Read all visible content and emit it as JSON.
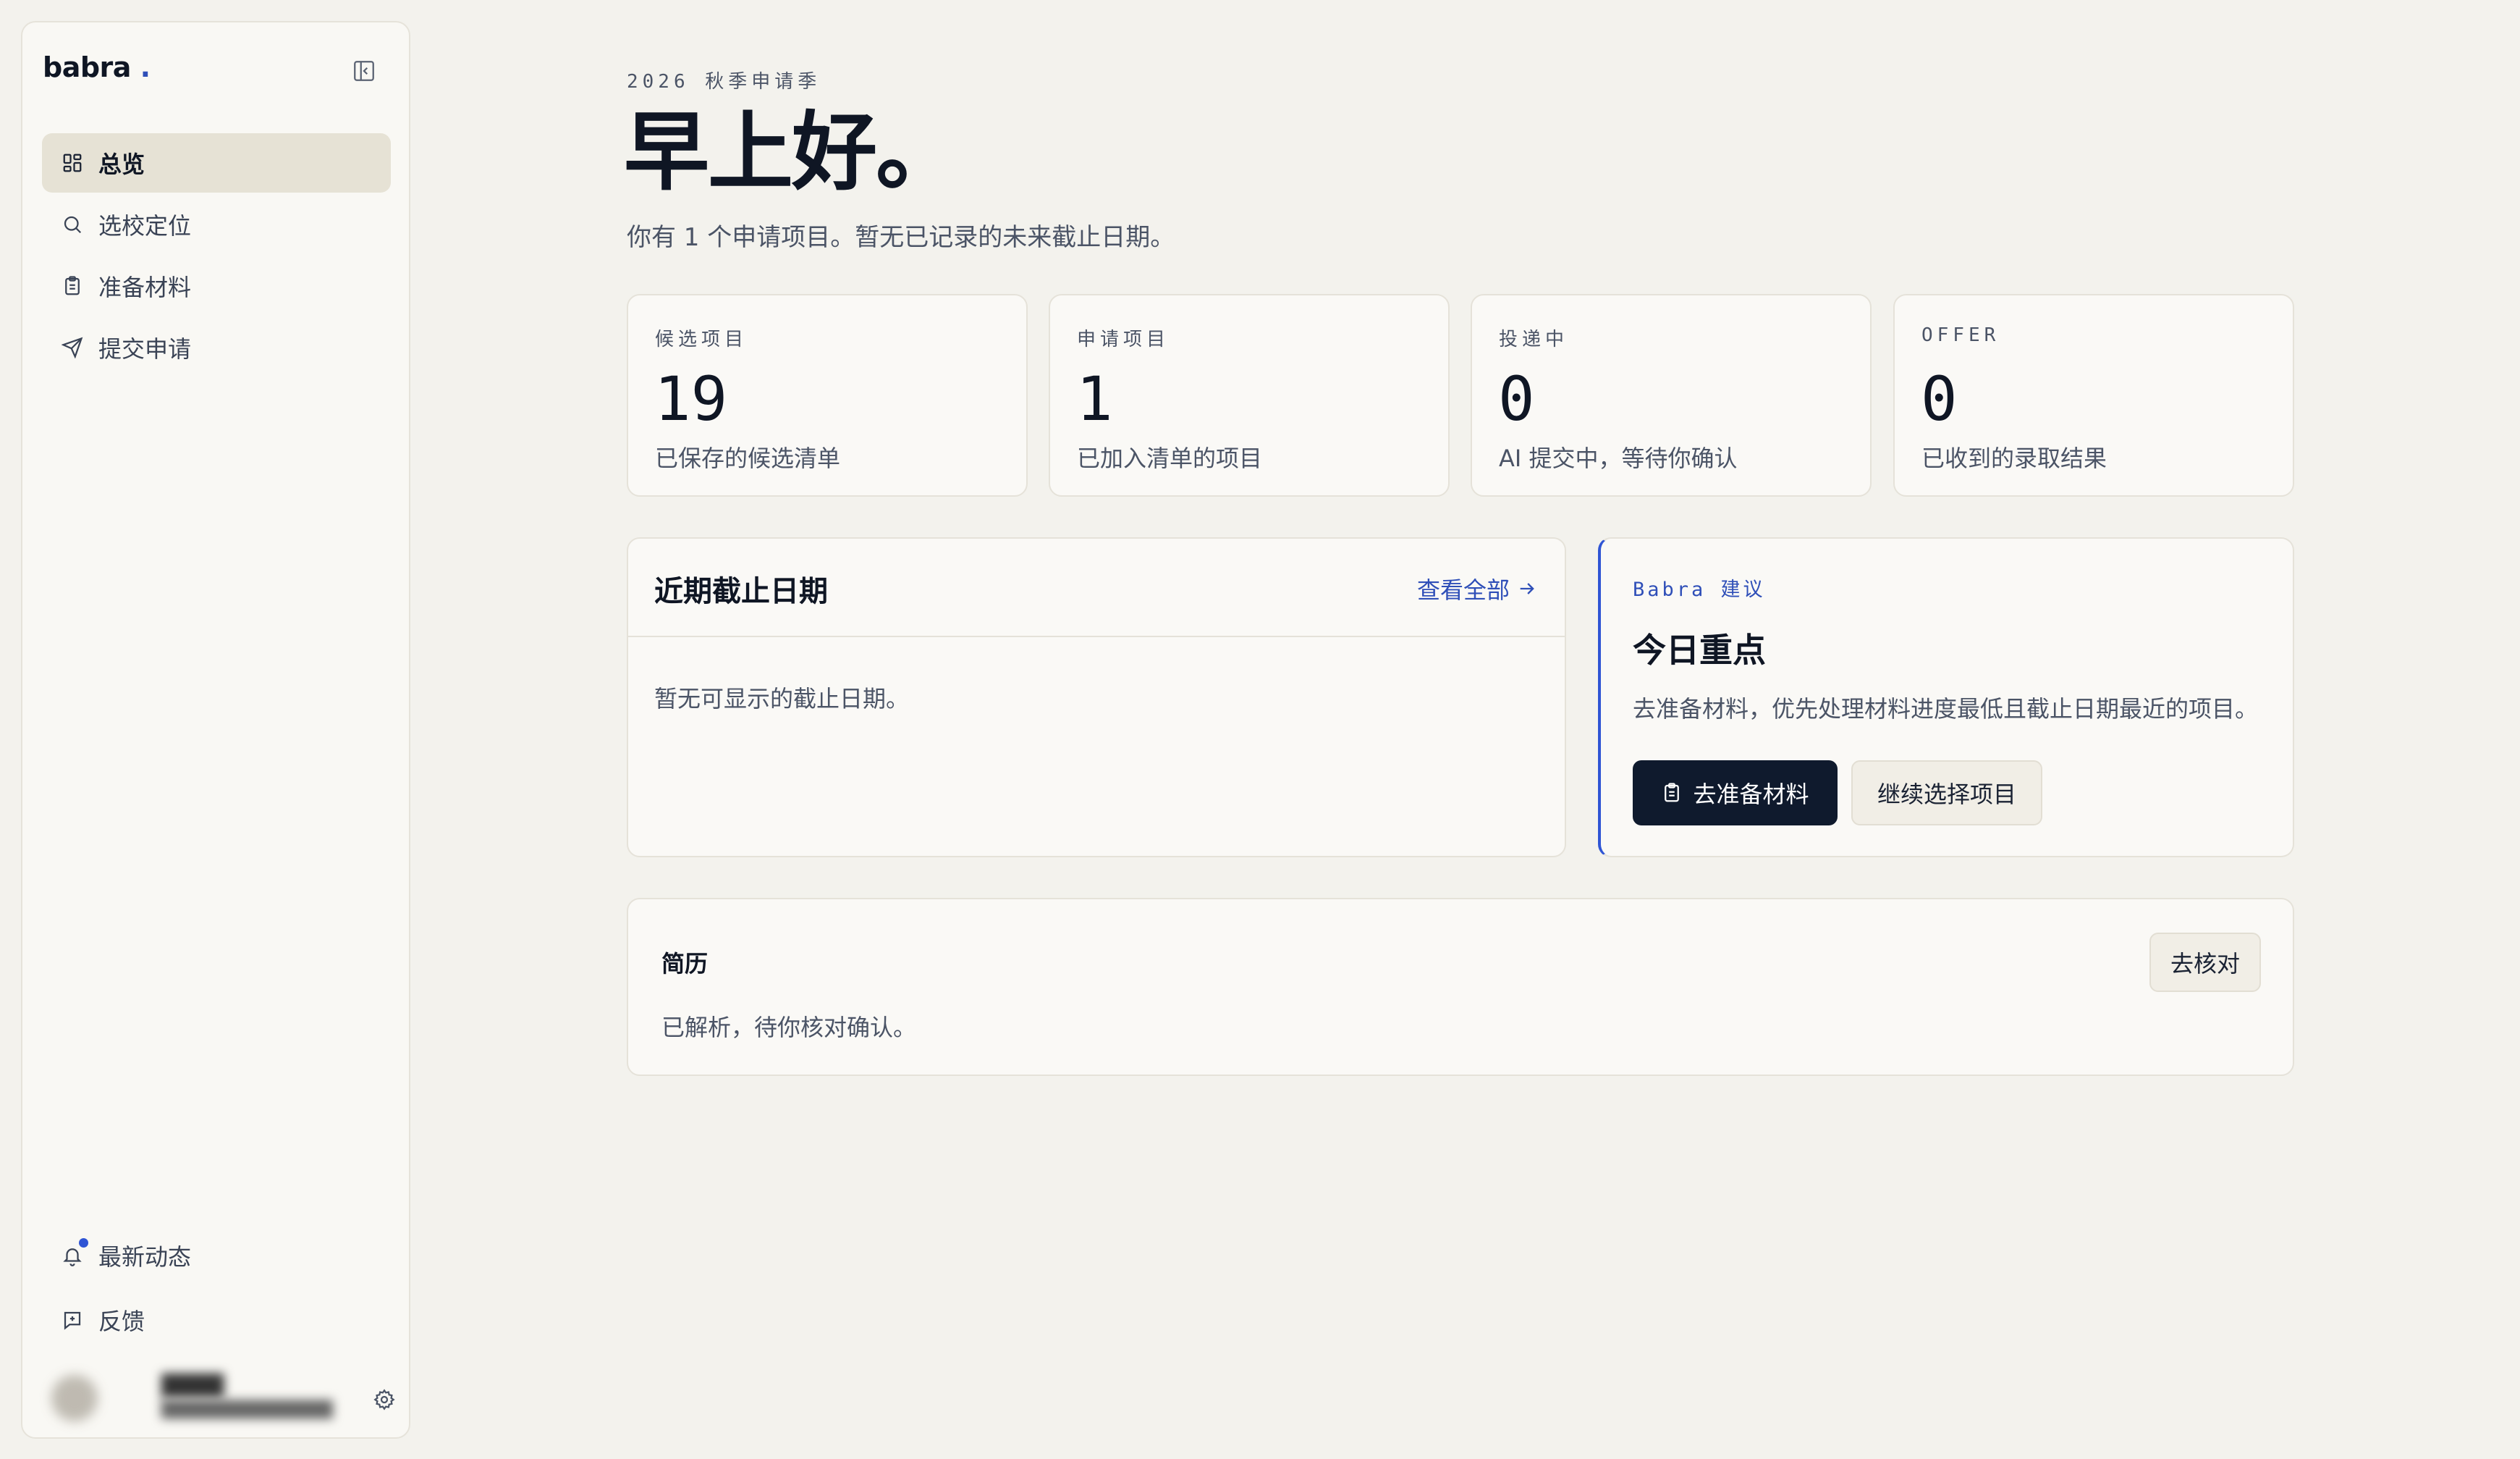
{
  "sidebar": {
    "brand": "babra",
    "brand_dot": ".",
    "items": [
      {
        "label": "总览",
        "icon": "dashboard-grid-icon",
        "active": true
      },
      {
        "label": "选校定位",
        "icon": "search-icon",
        "active": false
      },
      {
        "label": "准备材料",
        "icon": "clipboard-icon",
        "active": false
      },
      {
        "label": "提交申请",
        "icon": "send-icon",
        "active": false
      }
    ],
    "bottom_items": [
      {
        "label": "最新动态",
        "icon": "bell-icon",
        "has_notification": true
      },
      {
        "label": "反馈",
        "icon": "feedback-icon"
      }
    ]
  },
  "header": {
    "eyebrow": "2026 秋季申请季",
    "greeting": "早上好。",
    "subtitle": "你有 1 个申请项目。暂无已记录的未来截止日期。"
  },
  "stats": [
    {
      "label": "候选项目",
      "value": "19",
      "desc": "已保存的候选清单"
    },
    {
      "label": "申请项目",
      "value": "1",
      "desc": "已加入清单的项目"
    },
    {
      "label": "投递中",
      "value": "0",
      "desc": "AI 提交中，等待你确认"
    },
    {
      "label": "OFFER",
      "value": "0",
      "desc": "已收到的录取结果"
    }
  ],
  "deadlines": {
    "title": "近期截止日期",
    "view_all": "查看全部",
    "empty": "暂无可显示的截止日期。"
  },
  "suggestion": {
    "tag": "Babra 建议",
    "title": "今日重点",
    "desc": "去准备材料，优先处理材料进度最低且截止日期最近的项目。",
    "primary_button": "去准备材料",
    "secondary_button": "继续选择项目"
  },
  "resume": {
    "title": "简历",
    "desc": "已解析，待你核对确认。",
    "button": "去核对"
  },
  "colors": {
    "accent": "#2f4fb8",
    "primary_button": "#0f1a2d",
    "background": "#f3f2ed",
    "notification": "#2f55d4"
  }
}
